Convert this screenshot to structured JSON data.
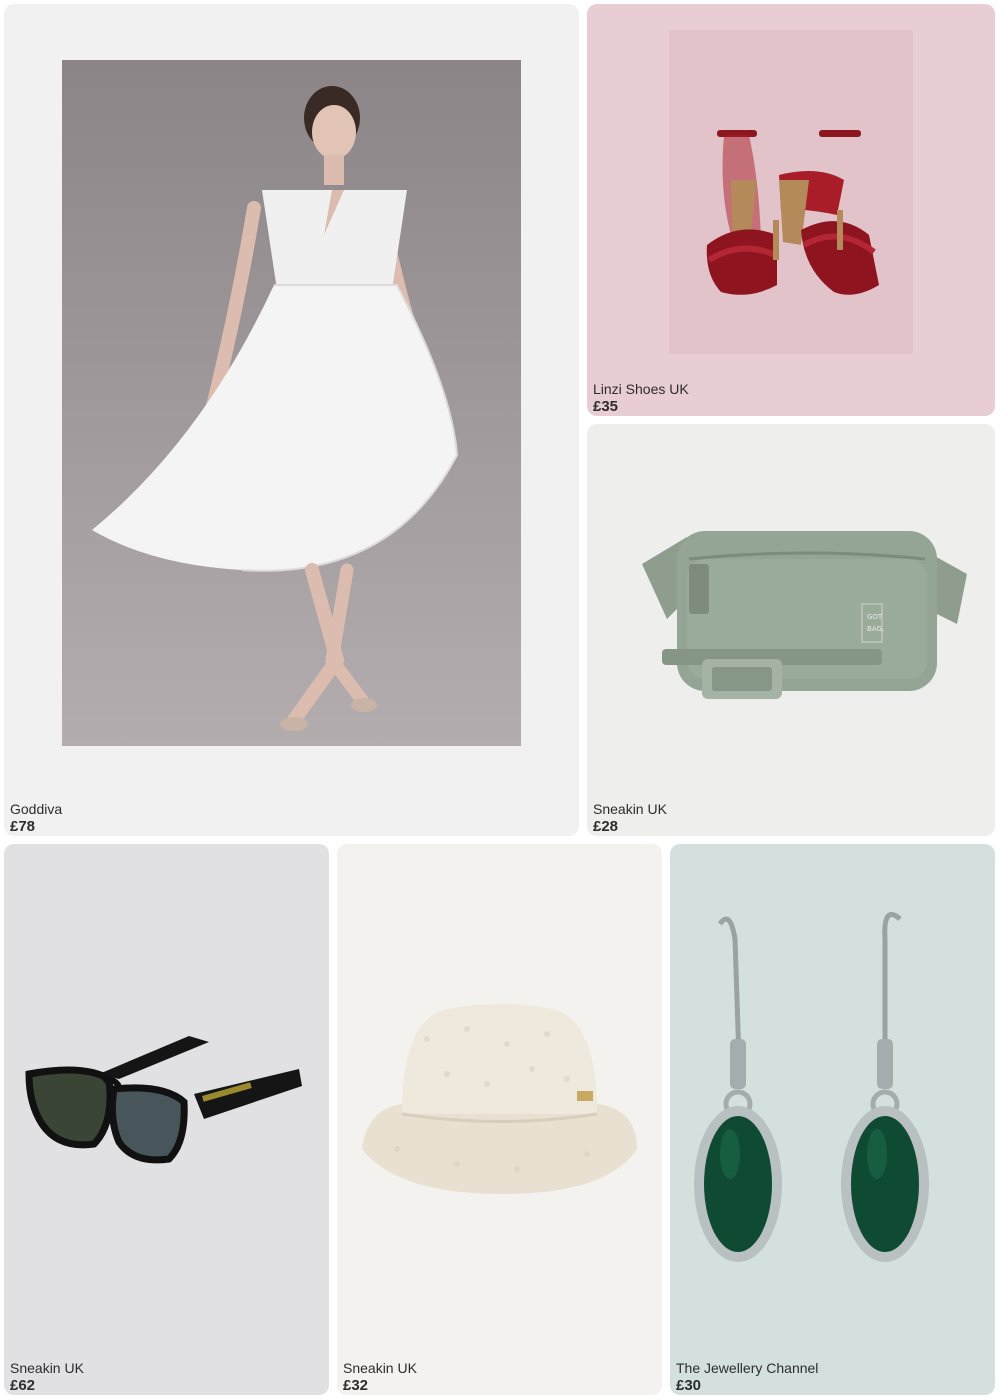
{
  "products": [
    {
      "store": "Goddiva",
      "price": "£78",
      "image": "white-midi-dress-image",
      "bg": "#f2f1f2"
    },
    {
      "store": "Linzi Shoes UK",
      "price": "£35",
      "image": "red-velvet-heels-image",
      "bg": "#e8cdd3"
    },
    {
      "store": "Sneakin UK",
      "price": "£28",
      "image": "green-belt-bag-image",
      "bg": "#eeeeed"
    },
    {
      "store": "Sneakin UK",
      "price": "£62",
      "image": "black-sunglasses-image",
      "bg": "#e1e1e3"
    },
    {
      "store": "Sneakin UK",
      "price": "£32",
      "image": "cream-bucket-hat-image",
      "bg": "#f3f2ef"
    },
    {
      "store": "The Jewellery Channel",
      "price": "£30",
      "image": "green-drop-earrings-image",
      "bg": "#d4e0dd"
    }
  ]
}
